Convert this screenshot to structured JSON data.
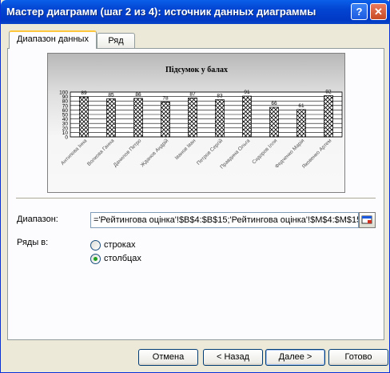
{
  "window": {
    "title": "Мастер диаграмм (шаг 2 из 4): источник данных диаграммы",
    "help_label": "?",
    "close_label": "✕"
  },
  "tabs": [
    {
      "label": "Диапазон данных",
      "active": true
    },
    {
      "label": "Ряд",
      "active": false
    }
  ],
  "chart_data": {
    "type": "bar",
    "title": "Підсумок у балах",
    "categories": [
      "Антипова Інна",
      "Волкова Ганна",
      "Данилов Петро",
      "Жданов Андрій",
      "Іванов Іван",
      "Петров Сергій",
      "Правдина Ольга",
      "Сидоров Ілля",
      "Федченко Марія",
      "Яковенко Артем"
    ],
    "values": [
      89,
      85,
      86,
      78,
      87,
      83,
      91,
      66,
      61,
      92
    ],
    "yticks": [
      0,
      10,
      20,
      30,
      40,
      50,
      60,
      70,
      80,
      90,
      100
    ],
    "ylim": [
      0,
      100
    ],
    "grid": true,
    "legend": false,
    "bar_pattern": "crosshatch",
    "data_labels": true
  },
  "range": {
    "label": "Диапазон:",
    "value": "='Рейтингова оцінка'!$B$4:$B$15;'Рейтингова оцінка'!$M$4:$M$15"
  },
  "series_in": {
    "label": "Ряды в:",
    "options": [
      {
        "label": "строках",
        "checked": false
      },
      {
        "label": "столбцах",
        "checked": true
      }
    ]
  },
  "buttons": {
    "cancel": "Отмена",
    "back": "< Назад",
    "next": "Далее >",
    "finish": "Готово"
  }
}
